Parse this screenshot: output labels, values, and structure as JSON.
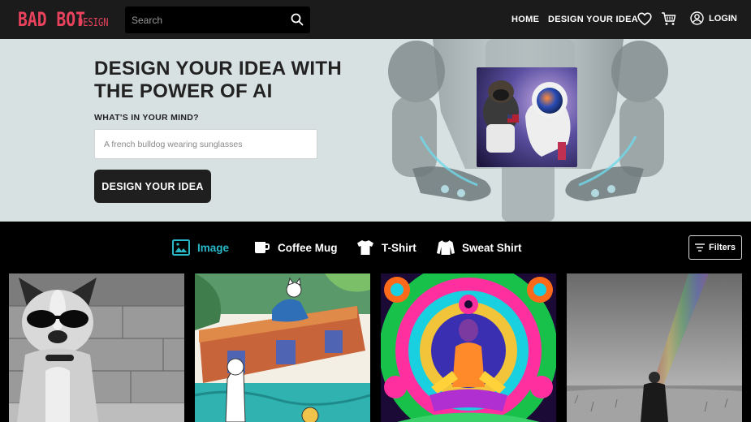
{
  "header": {
    "logo_main": "BAD BOT",
    "logo_sub": "DESIGN",
    "search_placeholder": "Search",
    "nav": {
      "home": "HOME",
      "design": "DESIGN YOUR IDEA",
      "login": "LOGIN"
    },
    "icons": [
      "search-icon",
      "heart-icon",
      "cart-icon",
      "user-circle-icon"
    ]
  },
  "hero": {
    "title": "DESIGN YOUR IDEA WITH THE POWER OF AI",
    "prompt_label": "WHAT'S IN YOUR MIND?",
    "input_placeholder": "A french bulldog wearing sunglasses",
    "button_label": "DESIGN YOUR IDEA"
  },
  "categories": [
    {
      "label": "Image",
      "icon": "image-icon",
      "active": true
    },
    {
      "label": "Coffee Mug",
      "icon": "mug-icon",
      "active": false
    },
    {
      "label": "T-Shirt",
      "icon": "tshirt-icon",
      "active": false
    },
    {
      "label": "Sweat Shirt",
      "icon": "sweatshirt-icon",
      "active": false
    }
  ],
  "filters_label": "Filters",
  "colors": {
    "accent": "#2ab8c8",
    "brand": "#e8425c",
    "header_bg": "#1b1b1b",
    "hero_bg": "#d8e1e2"
  },
  "gallery": [
    "bulldog-sunglasses-image",
    "watercolor-cats-image",
    "psychedelic-meditation-image",
    "man-rainbow-field-image"
  ]
}
